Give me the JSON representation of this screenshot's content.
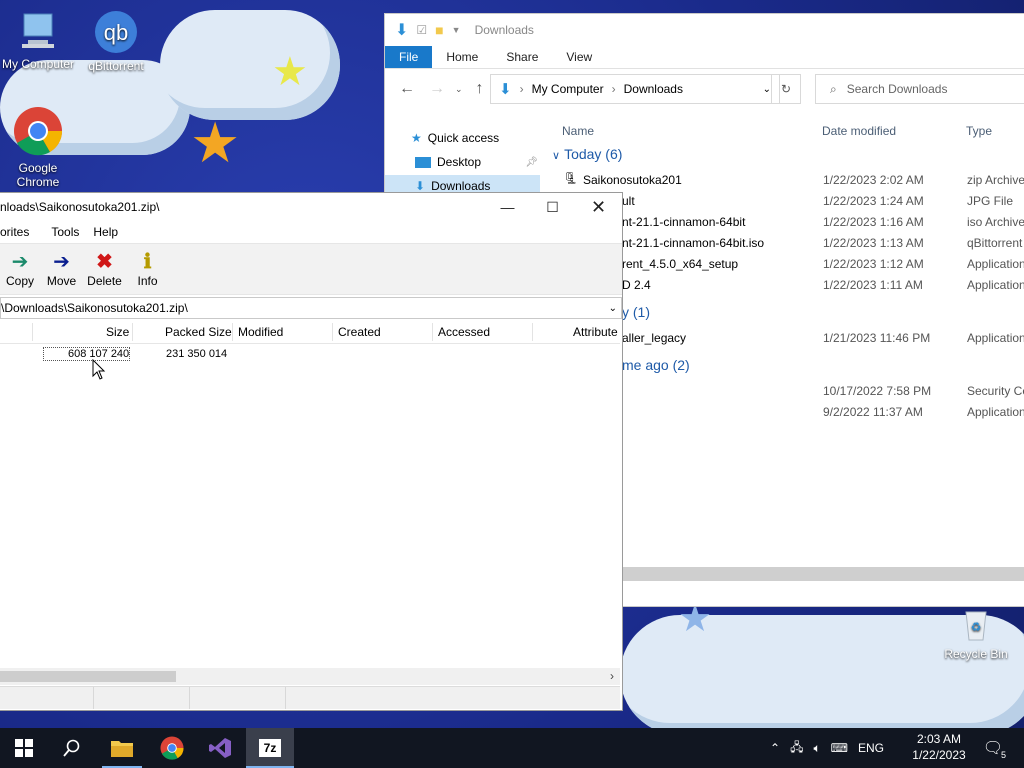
{
  "desktop": {
    "icons": [
      {
        "label": "My Computer"
      },
      {
        "label": "qBittorrent"
      },
      {
        "label": "Google Chrome"
      },
      {
        "label": "Recycle Bin"
      }
    ]
  },
  "explorer": {
    "title": "Downloads",
    "ribbon": [
      "File",
      "Home",
      "Share",
      "View"
    ],
    "address": {
      "root": "My Computer",
      "folder": "Downloads"
    },
    "search_placeholder": "Search Downloads",
    "nav": [
      {
        "label": "Quick access"
      },
      {
        "label": "Desktop"
      },
      {
        "label": "Downloads"
      }
    ],
    "columns": [
      "Name",
      "Date modified",
      "Type"
    ],
    "groups": [
      {
        "label": "Today (6)"
      },
      {
        "label": "y (1)"
      },
      {
        "label": "me ago (2)"
      }
    ],
    "rows": [
      {
        "name": "Saikonosutoka201",
        "date": "1/22/2023 2:02 AM",
        "type": "zip Archive"
      },
      {
        "name": "ult",
        "date": "1/22/2023 1:24 AM",
        "type": "JPG File"
      },
      {
        "name": "nt-21.1-cinnamon-64bit",
        "date": "1/22/2023 1:16 AM",
        "type": "iso Archive"
      },
      {
        "name": "nt-21.1-cinnamon-64bit.iso",
        "date": "1/22/2023 1:13 AM",
        "type": "qBittorrent"
      },
      {
        "name": "rent_4.5.0_x64_setup",
        "date": "1/22/2023 1:12 AM",
        "type": "Application"
      },
      {
        "name": "D 2.4",
        "date": "1/22/2023 1:11 AM",
        "type": "Application"
      },
      {
        "name": "aller_legacy",
        "date": "1/21/2023 11:46 PM",
        "type": "Application"
      },
      {
        "name": "",
        "date": "10/17/2022 7:58 PM",
        "type": "Security Ce"
      },
      {
        "name": "",
        "date": "9/2/2022 11:37 AM",
        "type": "Application"
      }
    ]
  },
  "sevenzip": {
    "title": "nloads\\Saikonosutoka201.zip\\",
    "menu": [
      "orites",
      "Tools",
      "Help"
    ],
    "toolbar": [
      "Copy",
      "Move",
      "Delete",
      "Info"
    ],
    "path": "\\Downloads\\Saikonosutoka201.zip\\",
    "columns": [
      "Size",
      "Packed Size",
      "Modified",
      "Created",
      "Accessed",
      "Attribute"
    ],
    "file": {
      "size": "608 107 240",
      "packed": "231 350 014"
    }
  },
  "taskbar": {
    "lang": "ENG",
    "time": "2:03 AM",
    "date": "1/22/2023",
    "notifications": "5"
  },
  "colors": {
    "accent": "#1979ca",
    "group": "#1e5aa8",
    "taskbar": "#111621"
  }
}
